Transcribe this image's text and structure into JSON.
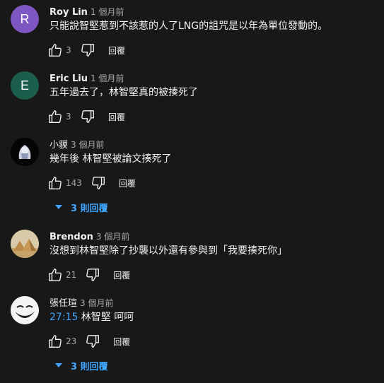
{
  "comments": [
    {
      "author": "Roy Lin",
      "time": "1 個月前",
      "avatar_letter": "R",
      "avatar_color": "#7e57c2",
      "text": "只能說智堅惹到不該惹的人了LNG的詛咒是以年為單位發動的。",
      "likes": "3",
      "reply_label": "回覆"
    },
    {
      "author": "Eric Liu",
      "time": "1 個月前",
      "avatar_letter": "E",
      "avatar_color": "#1b5e4b",
      "text": "五年過去了，林智堅真的被揍死了",
      "likes": "3",
      "reply_label": "回覆"
    },
    {
      "author": "小貘",
      "time": "3 個月前",
      "text": "幾年後 林智堅被論文揍死了",
      "likes": "143",
      "reply_label": "回覆",
      "replies_label": "3 則回覆"
    },
    {
      "author": "Brendon",
      "time": "3 個月前",
      "text": "沒想到林智堅除了抄襲以外還有參與到「我要揍死你」",
      "likes": "21",
      "reply_label": "回覆"
    },
    {
      "author": "張任瑄",
      "time": "3 個月前",
      "timestamp": "27:15",
      "text": " 林智堅 呵呵",
      "likes": "23",
      "reply_label": "回覆",
      "replies_label": "3 則回覆"
    }
  ],
  "colors": {
    "background": "#181818",
    "link": "#3ea6ff",
    "secondary_text": "#aaaaaa"
  },
  "icons": {
    "like": "thumbs-up-icon",
    "dislike": "thumbs-down-icon",
    "expand": "caret-down-icon"
  }
}
